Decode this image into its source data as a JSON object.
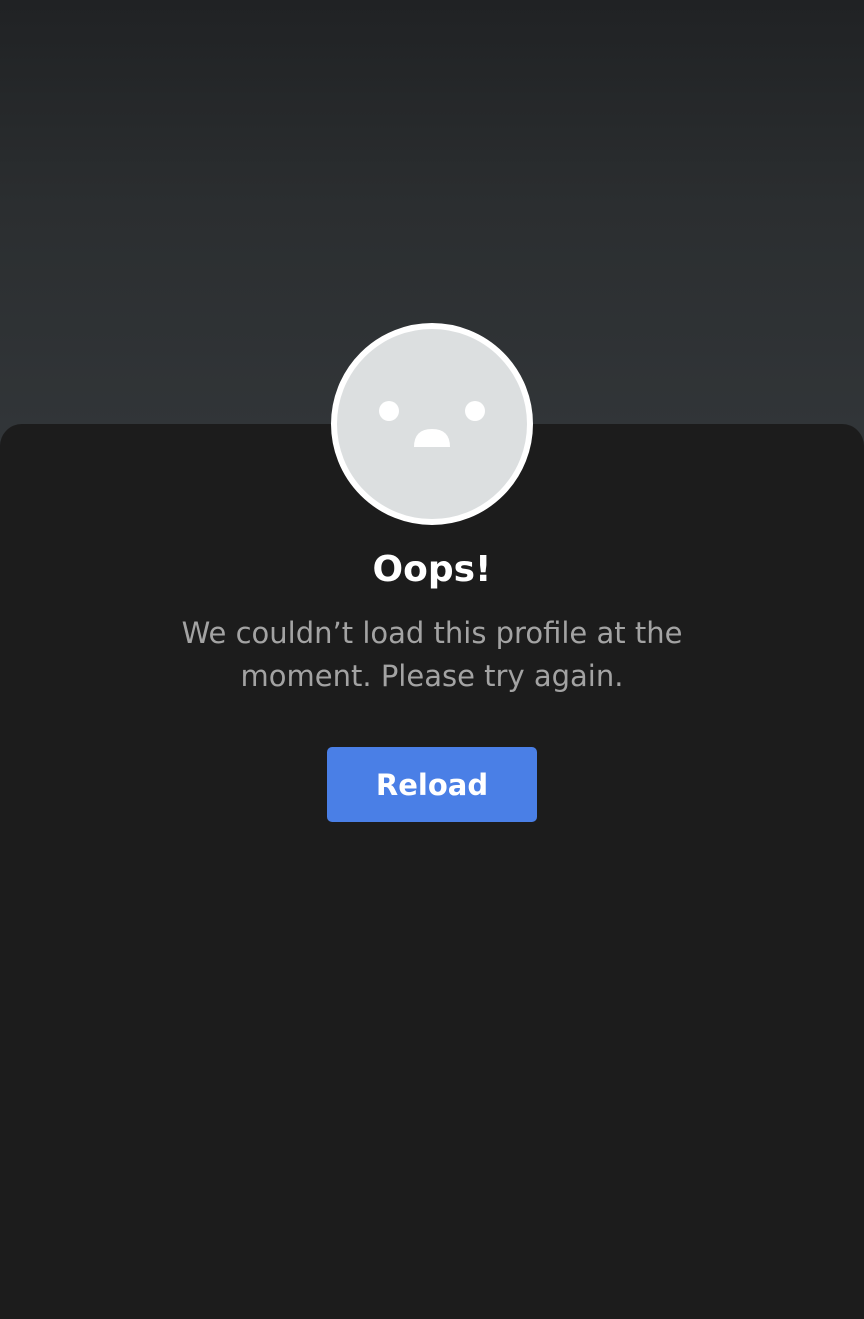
{
  "error": {
    "title": "Oops!",
    "message": "We couldn’t load this profile at the moment. Please try again.",
    "reload_label": "Reload",
    "avatar_icon": "sad-face-icon"
  },
  "colors": {
    "header_top": "#202224",
    "header_bottom": "#323639",
    "card_background": "#1c1c1c",
    "avatar_fill": "#dcdfe0",
    "avatar_ring": "#ffffff",
    "title_text": "#ffffff",
    "message_text": "#a3a3a3",
    "button_background": "#4a7fe6",
    "button_text": "#ffffff"
  }
}
